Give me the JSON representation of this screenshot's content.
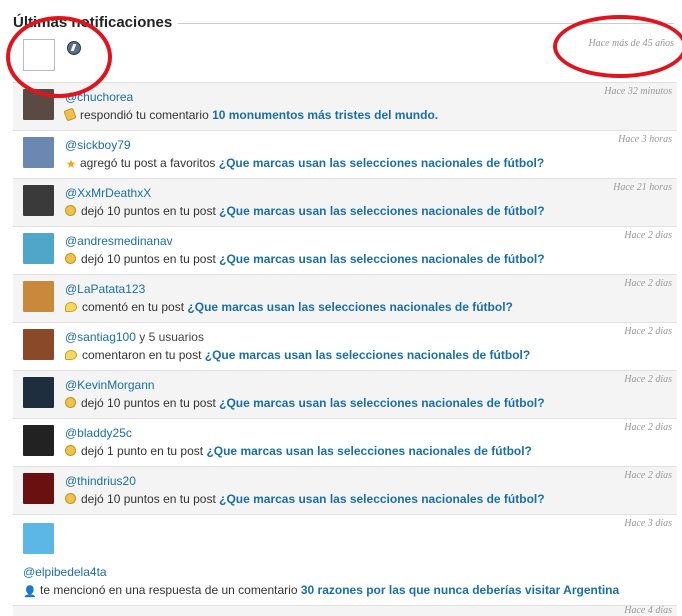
{
  "header": {
    "title": "Últimas notificaciones",
    "time": "Hace más de 45 años"
  },
  "notifications": [
    {
      "user": "@chuchorea",
      "extra": "",
      "icon": "reply-icon",
      "action": "respondió tu comentario",
      "link": "10 monumentos más tristes del mundo.",
      "time": "Hace 32 minutos",
      "avatar_color": "#5a4a44"
    },
    {
      "user": "@sickboy79",
      "extra": "",
      "icon": "star-icon",
      "action": "agregó tu post a favoritos",
      "link": "¿Que marcas usan las selecciones nacionales de fútbol?",
      "time": "Hace 3 horas",
      "avatar_color": "#6b88b0"
    },
    {
      "user": "@XxMrDeathxX",
      "extra": "",
      "icon": "coin-icon",
      "action": "dejó 10 puntos en tu post",
      "link": "¿Que marcas usan las selecciones nacionales de fútbol?",
      "time": "Hace 21 horas",
      "avatar_color": "#3a3a3a"
    },
    {
      "user": "@andresmedinanav",
      "extra": "",
      "icon": "coin-icon",
      "action": "dejó 10 puntos en tu post",
      "link": "¿Que marcas usan las selecciones nacionales de fútbol?",
      "time": "Hace 2 días",
      "avatar_color": "#4ea7c9"
    },
    {
      "user": "@LaPatata123",
      "extra": "",
      "icon": "comment-icon",
      "action": "comentó en tu post",
      "link": "¿Que marcas usan las selecciones nacionales de fútbol?",
      "time": "Hace 2 días",
      "avatar_color": "#c8893a"
    },
    {
      "user": "@santiag100",
      "extra": " y 5 usuarios",
      "icon": "comment-icon",
      "action": "comentaron en tu post",
      "link": "¿Que marcas usan las selecciones nacionales de fútbol?",
      "time": "Hace 2 días",
      "avatar_color": "#8a4a2a"
    },
    {
      "user": "@KevinMorgann",
      "extra": "",
      "icon": "coin-icon",
      "action": "dejó 10 puntos en tu post",
      "link": "¿Que marcas usan las selecciones nacionales de fútbol?",
      "time": "Hace 2 días",
      "avatar_color": "#1f2e3d"
    },
    {
      "user": "@bladdy25c",
      "extra": "",
      "icon": "coin-icon",
      "action": "dejó 1 punto en tu post",
      "link": "¿Que marcas usan las selecciones nacionales de fútbol?",
      "time": "Hace 2 días",
      "avatar_color": "#222222"
    },
    {
      "user": "@thindrius20",
      "extra": "",
      "icon": "coin-icon",
      "action": "dejó 10 puntos en tu post",
      "link": "¿Que marcas usan las selecciones nacionales de fútbol?",
      "time": "Hace 2 días",
      "avatar_color": "#6a1010"
    },
    {
      "user": "@elpibedela4ta",
      "extra": "",
      "icon": "mention-icon",
      "action": "te mencionó en una respuesta de un comentario",
      "link": "30 razones por las que nunca deberías visitar Argentina",
      "time": "Hace 3 días",
      "avatar_color": "#5cb6e6"
    }
  ],
  "trailing_time": "Hace 4 días"
}
